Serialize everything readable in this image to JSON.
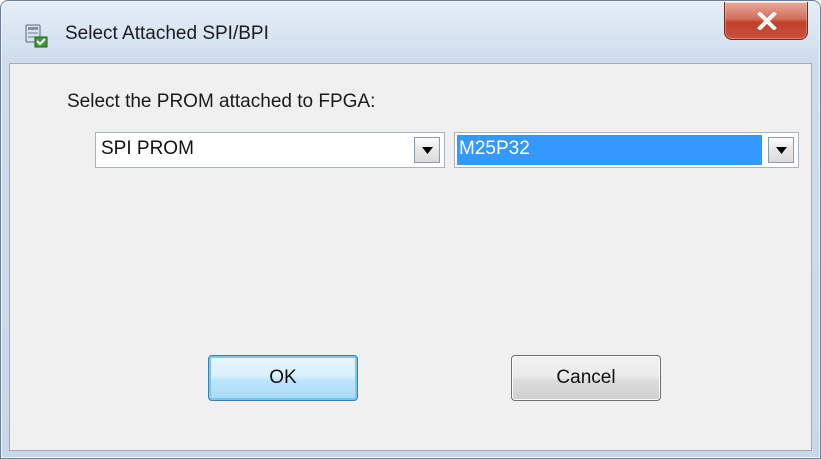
{
  "window": {
    "title": "Select Attached SPI/BPI",
    "app_icon": "programmer-icon",
    "close_icon": "close-icon"
  },
  "form": {
    "prompt_label": "Select the PROM attached to FPGA:",
    "prom_type": {
      "selected": "SPI PROM"
    },
    "prom_device": {
      "selected": "M25P32"
    }
  },
  "buttons": {
    "ok_label": "OK",
    "cancel_label": "Cancel"
  },
  "colors": {
    "selection": "#3399ff",
    "close_button": "#c0402b",
    "dialog_background": "#f0f0f0"
  }
}
